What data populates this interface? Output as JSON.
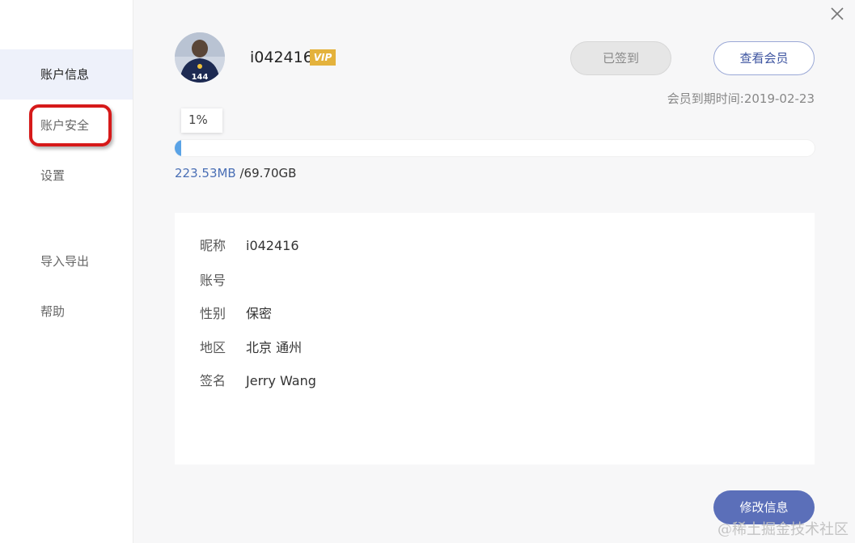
{
  "sidebar": {
    "items": [
      {
        "label": "账户信息",
        "active": true
      },
      {
        "label": "账户安全",
        "active": false
      },
      {
        "label": "设置",
        "active": false
      },
      {
        "label": "导入导出",
        "active": false
      },
      {
        "label": "帮助",
        "active": false
      }
    ]
  },
  "header": {
    "username": "i042416",
    "vip_label": "VIP",
    "signed_button": "已签到",
    "member_button": "查看会员",
    "expire_text": "会员到期时间:2019-02-23"
  },
  "storage": {
    "percent_label": "1%",
    "percent": 1,
    "used": "223.53MB",
    "total": "/69.70GB"
  },
  "profile": {
    "rows": [
      {
        "label": "昵称",
        "value": "i042416"
      },
      {
        "label": "账号",
        "value": ""
      },
      {
        "label": "性别",
        "value": "保密"
      },
      {
        "label": "地区",
        "value": "北京 通州"
      },
      {
        "label": "签名",
        "value": "Jerry Wang"
      }
    ],
    "edit_button": "修改信息"
  },
  "avatar": {
    "jersey_number": "144"
  },
  "watermark": "@稀土掘金技术社区",
  "colors": {
    "accent": "#5b6fb9",
    "vip": "#e4b23c",
    "progress": "#5aa3e6",
    "highlight": "#d61a1a"
  }
}
